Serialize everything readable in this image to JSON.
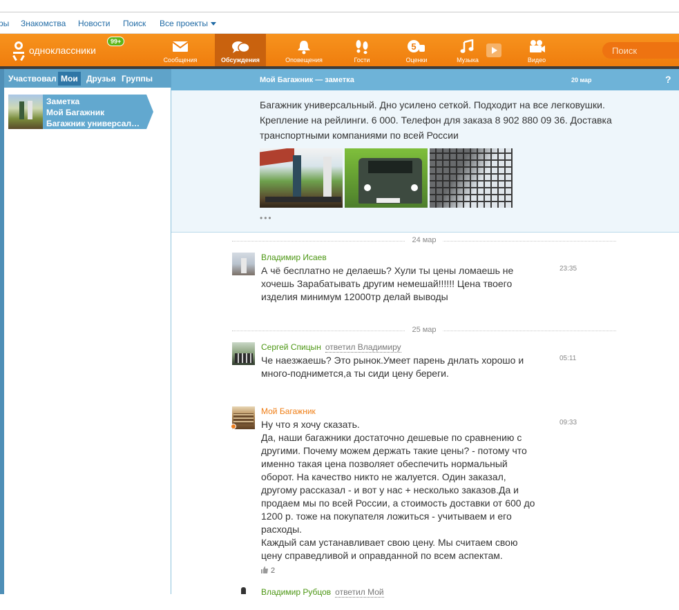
{
  "topnav": {
    "items": [
      "ры",
      "Знакомства",
      "Новости",
      "Поиск",
      "Все проекты"
    ]
  },
  "header": {
    "brand": "одноклассники",
    "notifications_badge": "99+",
    "tabs": [
      {
        "label": "Сообщения",
        "icon": "envelope-icon",
        "active": false
      },
      {
        "label": "Обсуждения",
        "icon": "speech-bubbles-icon",
        "active": true
      },
      {
        "label": "Оповещения",
        "icon": "bell-icon",
        "active": false
      },
      {
        "label": "Гости",
        "icon": "footprints-icon",
        "active": false
      },
      {
        "label": "Оценки",
        "icon": "five-rating-icon",
        "active": false
      },
      {
        "label": "Музыка",
        "icon": "music-note-icon",
        "active": false
      },
      {
        "label": "Видео",
        "icon": "video-camera-icon",
        "active": false
      }
    ],
    "search_placeholder": "Поиск",
    "accent": "#f7931e"
  },
  "left": {
    "tabs": [
      "Участвовал",
      "Мои",
      "Друзья",
      "Группы"
    ],
    "selected_tab": "Мои",
    "items": [
      {
        "type": "Заметка",
        "title": "Мой Багажник",
        "snippet": "Багажник универсаль..."
      }
    ]
  },
  "topic": {
    "title": "Мой Багажник — заметка",
    "date": "20 мар",
    "help": "?",
    "text": "Багажник универсальный. Дно усилено сеткой. Подходит на все легковушки. Крепление на рейлинги. 6 000. Телефон для заказа 8 902 880 09 36. Доставка транспортными компаниями по всей России",
    "more": "•••"
  },
  "feed": {
    "date1": "24 мар",
    "date2": "25 мар",
    "comments": [
      {
        "author": "Владимир Исаев",
        "reply_to": "",
        "text": "А чё бесплатно не делаешь? Хули ты цены ломаешь не хочешь Зарабатывать  другим немешай!!!!!! Цена твоего изделия минимум 12000тр делай выводы",
        "time": "23:35"
      },
      {
        "author": "Сергей Спицын",
        "reply_to": "ответил Владимиру",
        "text": "Че наезжаешь? Это рынок.Умеет парень днлать хорошо и много-поднимется,а ты сиди цену береги.",
        "time": "05:11"
      },
      {
        "author": "Мой Багажник",
        "reply_to": "",
        "text_lines": [
          "Ну что я хочу сказать.",
          "Да, наши багажники достаточно дешевые по сравнению с другими. Почему можем держать такие цены? - потому что именно такая цена позволяет обеспечить нормальный оборот. На качество никто не жалуется. Один заказал, другому рассказал - и вот у нас + несколько заказов.Да и продаем мы по всей России, а стоимость доставки от 600 до 1200 р. тоже на покупателя ложиться - учитываем и его расходы.",
          "Каждый сам устанавливает свою цену. Мы считаем свою цену справедливой и оправданной по всем аспектам."
        ],
        "time": "09:33",
        "likes": "2"
      },
      {
        "author": "Владимир Рубцов",
        "reply_to": "ответил Мой"
      }
    ]
  },
  "colors": {
    "blue_panel": "#6eb3d8",
    "green_name": "#4b9612",
    "orange_name": "#ef7d14"
  }
}
